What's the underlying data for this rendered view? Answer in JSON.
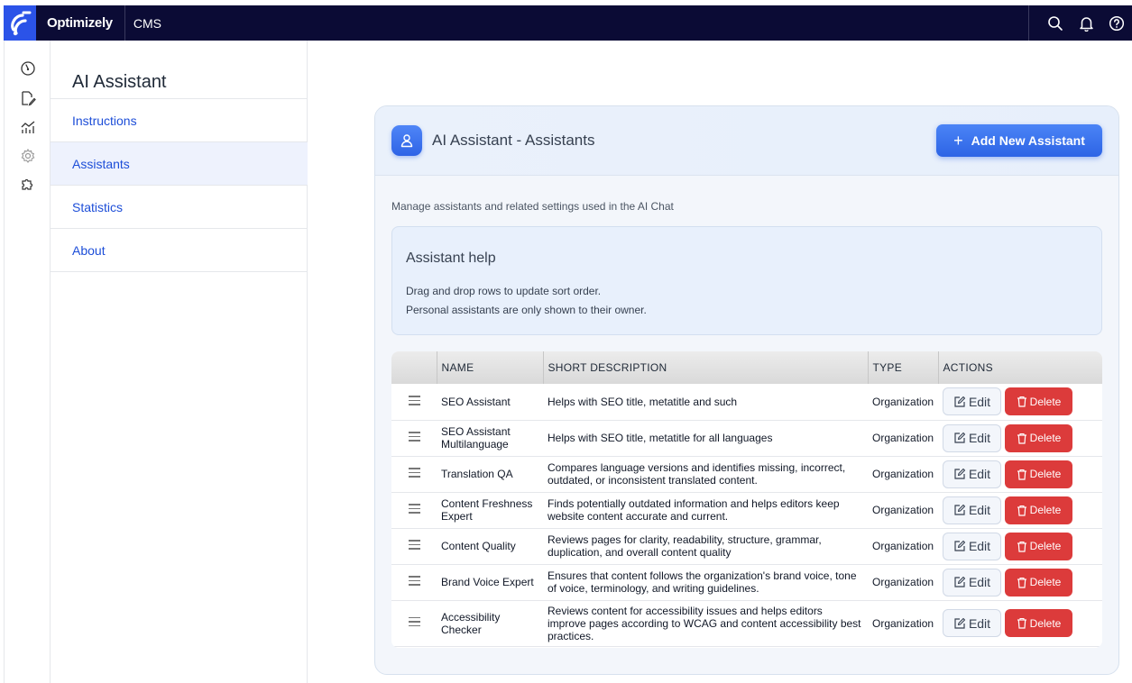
{
  "topbar": {
    "brand": "Optimizely",
    "product": "CMS"
  },
  "nav": {
    "title": "AI Assistant",
    "items": [
      {
        "label": "Instructions",
        "active": false
      },
      {
        "label": "Assistants",
        "active": true
      },
      {
        "label": "Statistics",
        "active": false
      },
      {
        "label": "About",
        "active": false
      }
    ]
  },
  "card": {
    "title": "AI Assistant - Assistants",
    "add_label": "Add New Assistant",
    "description": "Manage assistants and related settings used in the AI Chat",
    "help": {
      "title": "Assistant help",
      "line1": "Drag and drop rows to update sort order.",
      "line2": "Personal assistants are only shown to their owner."
    }
  },
  "table": {
    "headers": {
      "name": "NAME",
      "description": "SHORT DESCRIPTION",
      "type": "TYPE",
      "actions": "ACTIONS"
    },
    "edit_label": "Edit",
    "delete_label": "Delete",
    "rows": [
      {
        "name": "SEO Assistant",
        "description": "Helps with SEO title, metatitle and such",
        "type": "Organization"
      },
      {
        "name": "SEO Assistant Multilanguage",
        "description": "Helps with SEO title, metatitle for all languages",
        "type": "Organization"
      },
      {
        "name": "Translation QA",
        "description": "Compares language versions and identifies missing, incorrect, outdated, or inconsistent translated content.",
        "type": "Organization"
      },
      {
        "name": "Content Freshness Expert",
        "description": "Finds potentially outdated information and helps editors keep website content accurate and current.",
        "type": "Organization"
      },
      {
        "name": "Content Quality",
        "description": "Reviews pages for clarity, readability, structure, grammar, duplication, and overall content quality",
        "type": "Organization"
      },
      {
        "name": "Brand Voice Expert",
        "description": "Ensures that content follows the organization's brand voice, tone of voice, terminology, and writing guidelines.",
        "type": "Organization"
      },
      {
        "name": "Accessibility Checker",
        "description": "Reviews content for accessibility issues and helps editors improve pages according to WCAG and content accessibility best practices.",
        "type": "Organization"
      }
    ]
  },
  "colors": {
    "topbar": "#0b0b35",
    "brand_blue": "#2b53e8",
    "link": "#1d4ed8",
    "primary": "#2d64e5",
    "danger": "#dc3b3b"
  }
}
